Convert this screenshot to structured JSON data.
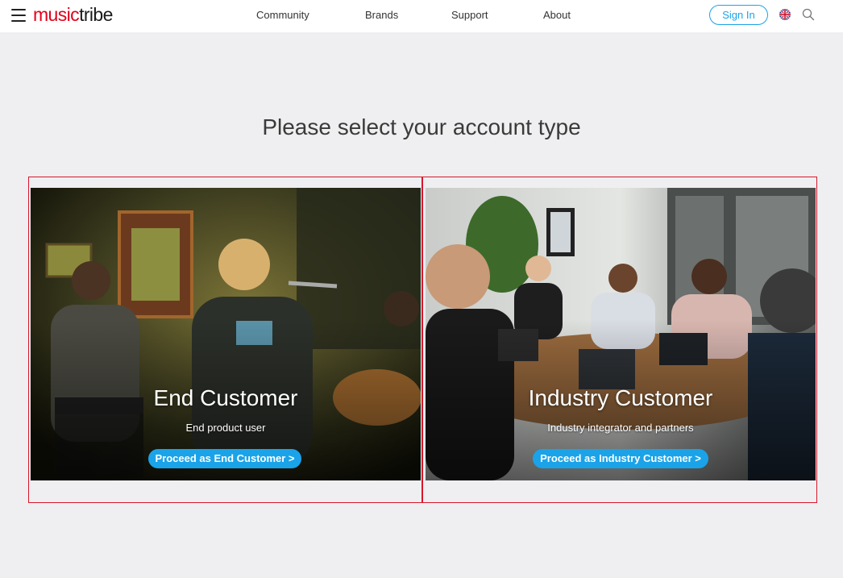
{
  "header": {
    "logo": {
      "part1": "music",
      "part2": "tribe"
    },
    "nav": [
      "Community",
      "Brands",
      "Support",
      "About"
    ],
    "sign_in_label": "Sign In",
    "icons": {
      "menu": "hamburger-menu-icon",
      "language": "uk-flag-icon",
      "search": "search-icon"
    }
  },
  "main": {
    "title": "Please select your account type",
    "cards": [
      {
        "title": "End Customer",
        "subtitle": "End product user",
        "button_label": "Proceed as End Customer >"
      },
      {
        "title": "Industry Customer",
        "subtitle": "Industry integrator and partners",
        "button_label": "Proceed as Industry Customer >"
      }
    ]
  },
  "colors": {
    "brand_red": "#e2001a",
    "accent_blue": "#1aa3e8",
    "card_border": "#d8162b",
    "page_background": "#efeff1"
  }
}
